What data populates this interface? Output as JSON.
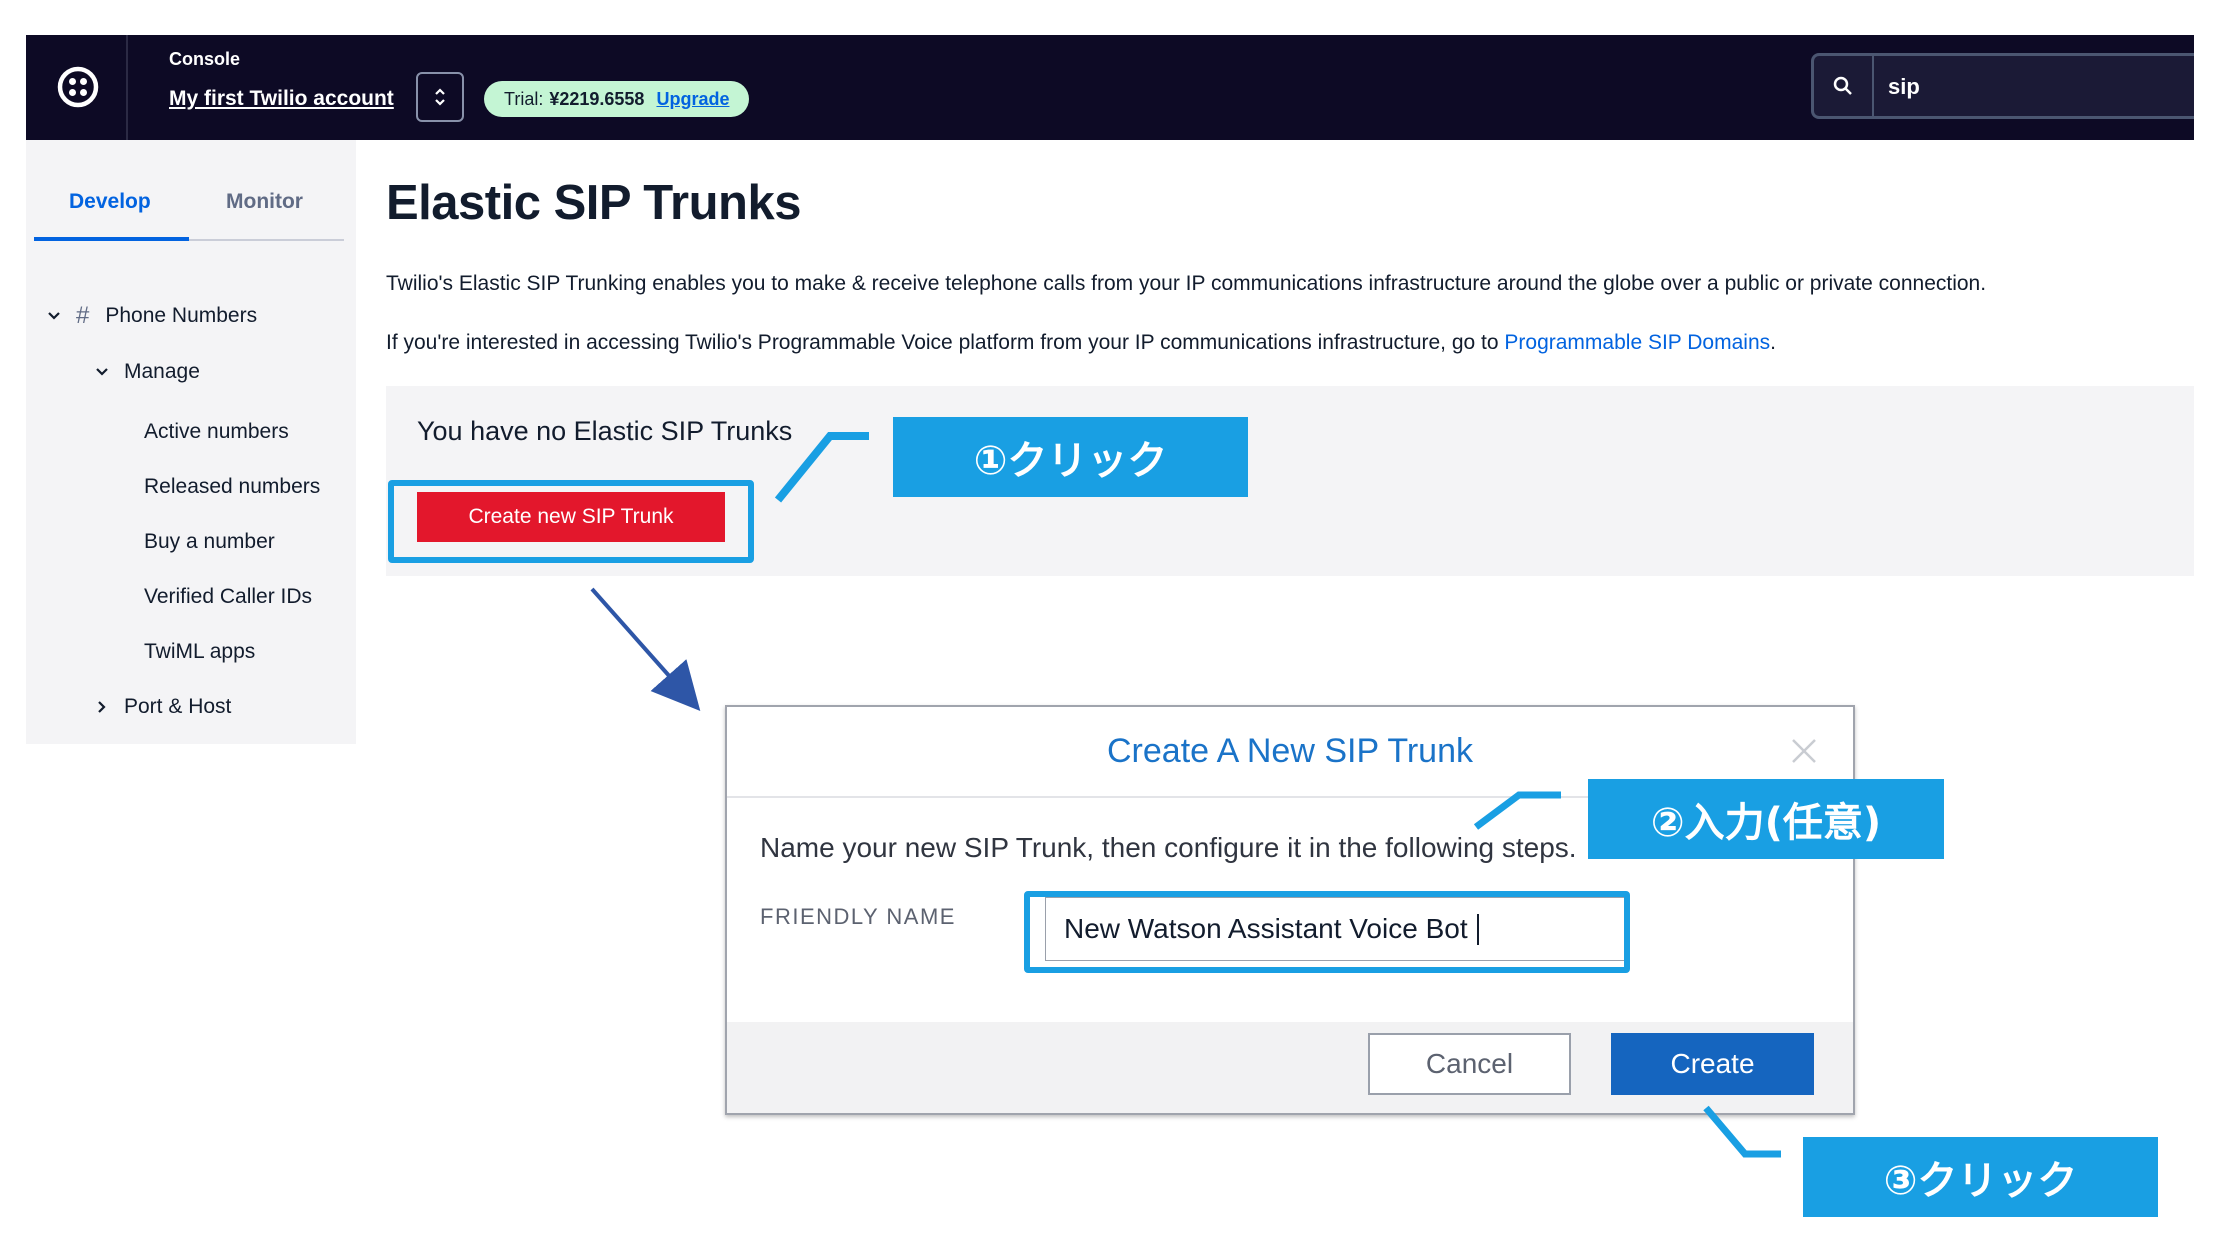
{
  "topbar": {
    "console_label": "Console",
    "account_name": "My first Twilio account",
    "trial_label": "Trial:",
    "trial_amount": "¥2219.6558",
    "upgrade_label": "Upgrade",
    "search_value": "sip"
  },
  "sidebar": {
    "tabs": [
      "Develop",
      "Monitor"
    ],
    "active_tab": "Develop",
    "items": {
      "phone_numbers": "Phone Numbers",
      "manage": "Manage",
      "active_numbers": "Active numbers",
      "released_numbers": "Released numbers",
      "buy_number": "Buy a number",
      "verified_caller_ids": "Verified Caller IDs",
      "twiml_apps": "TwiML apps",
      "port_host": "Port & Host"
    }
  },
  "main": {
    "title": "Elastic SIP Trunks",
    "desc1": "Twilio's Elastic SIP Trunking enables you to make & receive telephone calls from your IP communications infrastructure around the globe over a public or private connection.",
    "desc2_prefix": "If you're interested in accessing Twilio's Programmable Voice platform from your IP communications infrastructure, go to ",
    "desc2_link": "Programmable SIP Domains",
    "desc2_suffix": ".",
    "empty_text": "You have no Elastic SIP Trunks",
    "create_button": "Create new SIP Trunk"
  },
  "dialog": {
    "title": "Create A New SIP Trunk",
    "description": "Name your new SIP Trunk, then configure it in the following steps.",
    "field_label": "FRIENDLY NAME",
    "field_value": "New Watson Assistant Voice Bot",
    "cancel_label": "Cancel",
    "create_label": "Create"
  },
  "annotations": {
    "step1": "①クリック",
    "step2": "②入力(任意)",
    "step3": "③クリック",
    "color": "#199fe3"
  },
  "colors": {
    "topbar_bg": "#0d0a25",
    "accent_blue": "#0263e0",
    "create_red": "#e3172c",
    "dialog_create_blue": "#1565bf"
  }
}
